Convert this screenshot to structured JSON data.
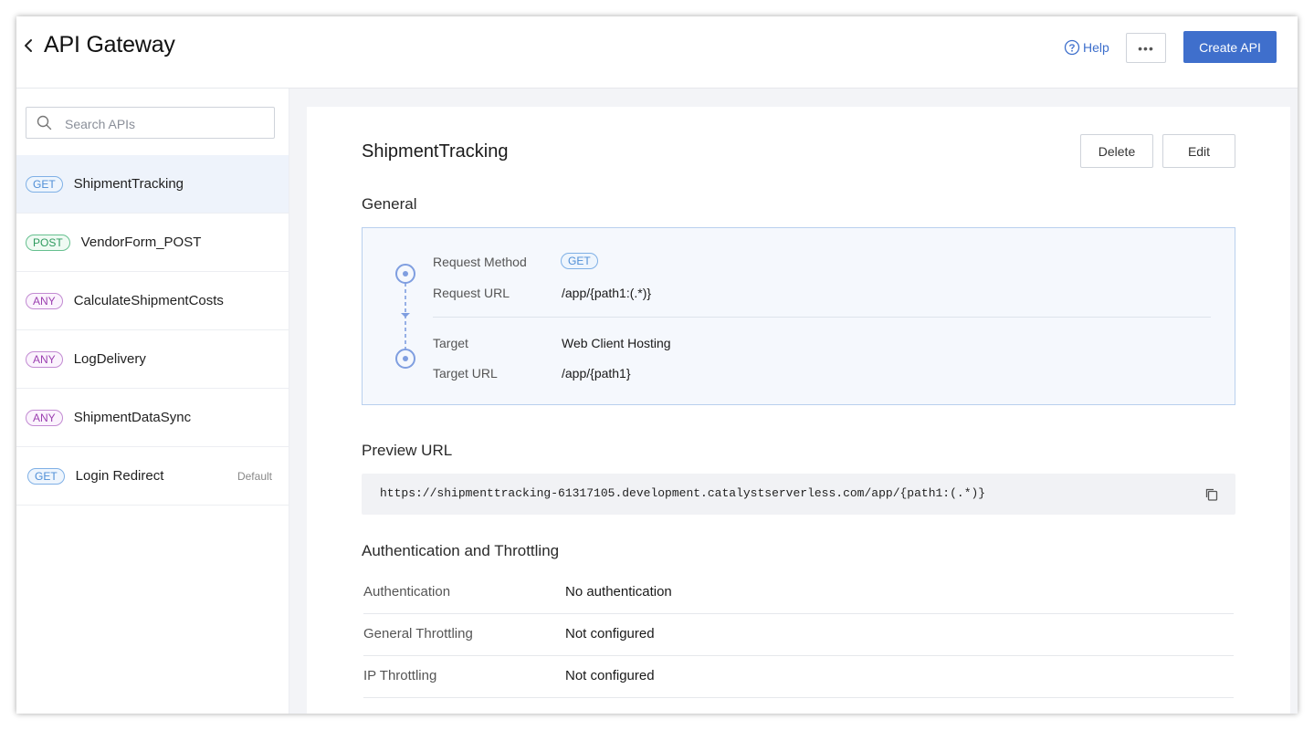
{
  "header": {
    "title": "API Gateway",
    "help_label": "Help",
    "more_label": "•••",
    "create_label": "Create API"
  },
  "sidebar": {
    "search_placeholder": "Search APIs",
    "items": [
      {
        "method": "GET",
        "name": "ShipmentTracking",
        "selected": true,
        "tag": ""
      },
      {
        "method": "POST",
        "name": "VendorForm_POST",
        "selected": false,
        "tag": ""
      },
      {
        "method": "ANY",
        "name": "CalculateShipmentCosts",
        "selected": false,
        "tag": ""
      },
      {
        "method": "ANY",
        "name": "LogDelivery",
        "selected": false,
        "tag": ""
      },
      {
        "method": "ANY",
        "name": "ShipmentDataSync",
        "selected": false,
        "tag": ""
      },
      {
        "method": "GET",
        "name": "Login Redirect",
        "selected": false,
        "tag": "Default"
      }
    ]
  },
  "detail": {
    "title": "ShipmentTracking",
    "delete_label": "Delete",
    "edit_label": "Edit",
    "general_title": "General",
    "general": {
      "request_method_label": "Request Method",
      "request_method_value": "GET",
      "request_url_label": "Request URL",
      "request_url_value": "/app/{path1:(.*)}",
      "target_label": "Target",
      "target_value": "Web Client Hosting",
      "target_url_label": "Target URL",
      "target_url_value": "/app/{path1}"
    },
    "preview_title": "Preview URL",
    "preview_url": "https://shipmenttracking-61317105.development.catalystserverless.com/app/{path1:(.*)}",
    "auth_title": "Authentication and Throttling",
    "auth_rows": [
      {
        "label": "Authentication",
        "value": "No authentication"
      },
      {
        "label": "General Throttling",
        "value": "Not configured"
      },
      {
        "label": "IP Throttling",
        "value": "Not configured"
      }
    ]
  },
  "colors": {
    "accent": "#3f6fcc",
    "get": "#4f8ed6",
    "post": "#2e9a5e",
    "any": "#9b3fb0"
  },
  "icons": {
    "back": "chevron-left-icon",
    "help": "question-circle-icon",
    "search": "search-icon",
    "copy": "copy-icon",
    "flow": "request-flow-icon"
  }
}
